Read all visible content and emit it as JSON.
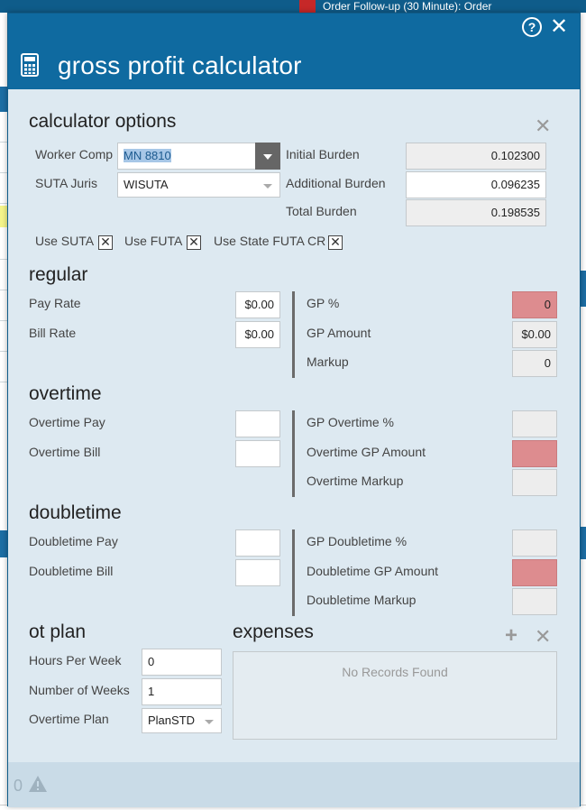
{
  "background": {
    "notification": "Order Follow-up (30 Minute): Order"
  },
  "dialog": {
    "title": "gross profit calculator",
    "help_icon": "question-circle-icon",
    "close_icon": "close-x-icon"
  },
  "options": {
    "title": "calculator options",
    "worker_comp_label": "Worker Comp",
    "worker_comp_value": "MN 8810",
    "suta_juris_label": "SUTA Juris",
    "suta_juris_value": "WISUTA",
    "initial_burden_label": "Initial Burden",
    "initial_burden_value": "0.102300",
    "additional_burden_label": "Additional Burden",
    "additional_burden_value": "0.096235",
    "total_burden_label": "Total Burden",
    "total_burden_value": "0.198535",
    "use_suta_label": "Use SUTA",
    "use_futa_label": "Use FUTA",
    "use_state_futa_label": "Use State FUTA CR",
    "check_mark": "✕"
  },
  "regular": {
    "title": "regular",
    "pay_rate_label": "Pay Rate",
    "pay_rate_value": "$0.00",
    "bill_rate_label": "Bill Rate",
    "bill_rate_value": "$0.00",
    "gp_percent_label": "GP %",
    "gp_percent_value": "0",
    "gp_amount_label": "GP Amount",
    "gp_amount_value": "$0.00",
    "markup_label": "Markup",
    "markup_value": "0"
  },
  "overtime": {
    "title": "overtime",
    "pay_label": "Overtime Pay",
    "bill_label": "Overtime Bill",
    "gp_percent_label": "GP Overtime %",
    "gp_amount_label": "Overtime GP Amount",
    "markup_label": "Overtime Markup"
  },
  "doubletime": {
    "title": "doubletime",
    "pay_label": "Doubletime Pay",
    "bill_label": "Doubletime Bill",
    "gp_percent_label": "GP Doubletime %",
    "gp_amount_label": "Doubletime GP Amount",
    "markup_label": "Doubletime Markup"
  },
  "ot_plan": {
    "title": "ot plan",
    "hours_label": "Hours Per Week",
    "hours_value": "0",
    "weeks_label": "Number of Weeks",
    "weeks_value": "1",
    "plan_label": "Overtime Plan",
    "plan_value": "PlanSTD"
  },
  "expenses": {
    "title": "expenses",
    "add_icon": "plus-icon",
    "remove_icon": "close-x-icon",
    "empty_text": "No Records Found"
  },
  "footer": {
    "count": "0",
    "warning_icon": "warning-triangle-icon"
  }
}
